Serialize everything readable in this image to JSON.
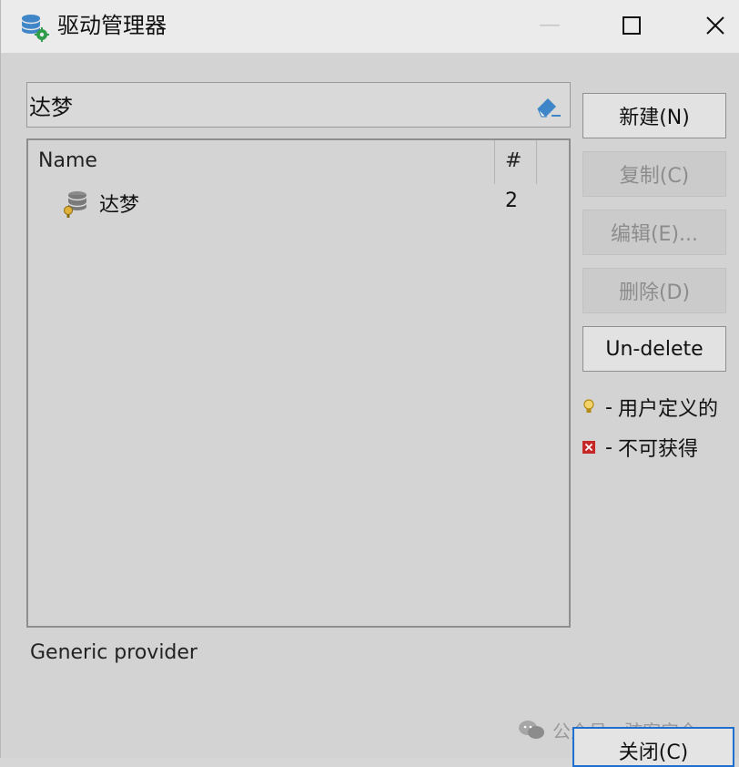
{
  "window": {
    "title": "驱动管理器"
  },
  "search": {
    "value": "达梦"
  },
  "table": {
    "columns": [
      "Name",
      "#"
    ],
    "rows": [
      {
        "name": "达梦",
        "count": "2"
      }
    ]
  },
  "buttons": {
    "new": "新建(N)",
    "copy": "复制(C)",
    "edit": "编辑(E)...",
    "delete": "删除(D)",
    "undelete": "Un-delete",
    "close": "关闭(C)"
  },
  "legend": {
    "user_defined": "用户定义的",
    "unavailable": "不可获得",
    "separator": "-"
  },
  "status": {
    "provider": "Generic provider"
  },
  "watermark": {
    "text": "公众号 · 骇客安全"
  },
  "colors": {
    "accent": "#1f6fd1",
    "db_icon": "#3f86c8",
    "legend_bulb": "#d9a521",
    "legend_x": "#c62828"
  }
}
